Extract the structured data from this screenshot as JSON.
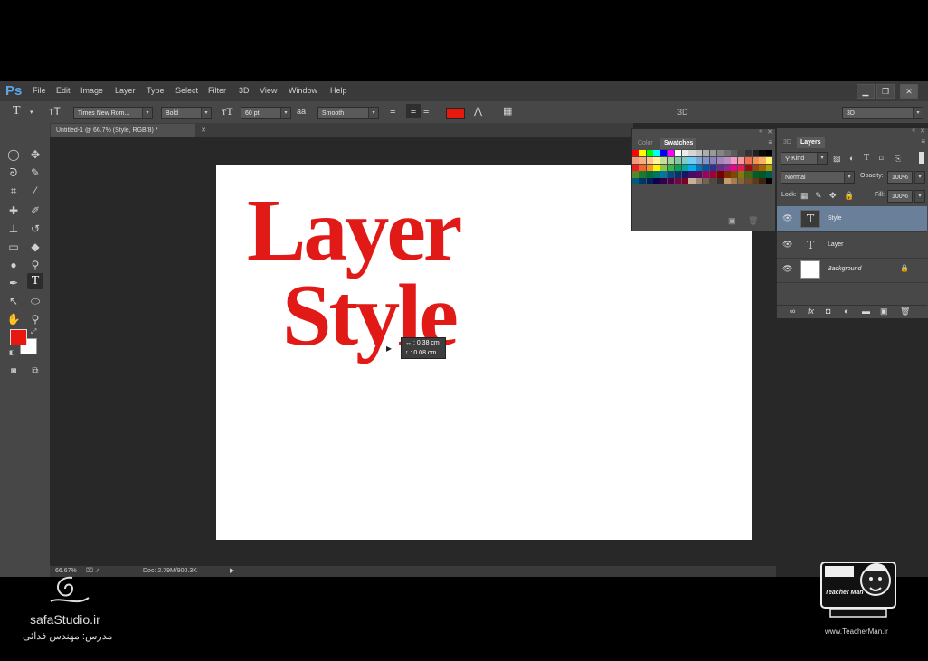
{
  "menubar": {
    "logo": "Ps",
    "items": [
      "File",
      "Edit",
      "Image",
      "Layer",
      "Type",
      "Select",
      "Filter",
      "3D",
      "View",
      "Window",
      "Help"
    ]
  },
  "options": {
    "font_family": "Times New Rom...",
    "font_style": "Bold",
    "font_size": "60 pt",
    "aa_icon_text": "aa",
    "antialias": "Smooth",
    "threed_label": "3D",
    "workspace": "3D",
    "text_color": "#e8180f"
  },
  "document": {
    "tab_title": "Untitled-1 @ 66.7% (Style, RGB/8) *",
    "line1": "Layer",
    "line2": "Style",
    "measure_w": "↔ : 0.38 cm",
    "measure_h": "↕ : 0.08 cm"
  },
  "status": {
    "zoom": "66.67%",
    "doc_size": "Doc: 2.79M/900.3K"
  },
  "swatches": {
    "tab_color": "Color",
    "tab_swatches": "Swatches",
    "colors": [
      "#ff0000",
      "#ffff00",
      "#00ff00",
      "#00ffff",
      "#0000ff",
      "#ff00ff",
      "#ffffff",
      "#ebebeb",
      "#d6d6d6",
      "#c2c2c2",
      "#adadad",
      "#999999",
      "#858585",
      "#707070",
      "#5c5c5c",
      "#474747",
      "#333333",
      "#1f1f1f",
      "#0a0a0a",
      "#000000",
      "#f7977a",
      "#f9ad81",
      "#fdc68a",
      "#fff79a",
      "#c4df9b",
      "#a3d39c",
      "#82ca9d",
      "#7bcdc8",
      "#6ecff6",
      "#7ea7d8",
      "#8493ca",
      "#8882be",
      "#a187be",
      "#bc8dbf",
      "#f49ac2",
      "#f6989d",
      "#f26c4f",
      "#f68e55",
      "#fbaf5c",
      "#fff467",
      "#ed1c24",
      "#f26522",
      "#f7941d",
      "#fff200",
      "#8dc73f",
      "#39b54a",
      "#00a651",
      "#00a99d",
      "#00aeef",
      "#0072bc",
      "#0054a6",
      "#2e3192",
      "#662d91",
      "#92278f",
      "#ec008c",
      "#ed145b",
      "#9e0b0f",
      "#a0410d",
      "#a3620a",
      "#aba000",
      "#598527",
      "#197b30",
      "#007236",
      "#00746b",
      "#0076a3",
      "#004b80",
      "#003471",
      "#1b1464",
      "#440e62",
      "#630460",
      "#9e005d",
      "#9e0039",
      "#790000",
      "#7b2e00",
      "#7d4900",
      "#827b00",
      "#406618",
      "#005e20",
      "#005826",
      "#005952",
      "#005b7f",
      "#003663",
      "#002157",
      "#0d004c",
      "#32004b",
      "#4b0049",
      "#7b0046",
      "#7a0026",
      "#c7b299",
      "#998675",
      "#736357",
      "#534741",
      "#37302d",
      "#c69c6d",
      "#a67c52",
      "#8c6239",
      "#754c24",
      "#603913",
      "#3c2415",
      "#000000"
    ]
  },
  "layers": {
    "tab_3d": "3D",
    "tab_layers": "Layers",
    "kind": "Kind",
    "blend_mode": "Normal",
    "opacity_label": "Opacity:",
    "opacity_value": "100%",
    "lock_label": "Lock:",
    "fill_label": "Fill:",
    "fill_value": "100%",
    "items": [
      {
        "name": "Style",
        "thumb": "T"
      },
      {
        "name": "Layer",
        "thumb": "T"
      },
      {
        "name": "Background",
        "thumb": ""
      }
    ]
  },
  "branding": {
    "site": "safaStudio.ir",
    "persian": "مدرس: مهندس فدائی",
    "teacher_url": "www.TeacherMan.ir",
    "teacher_logo": "Teacher Man"
  }
}
